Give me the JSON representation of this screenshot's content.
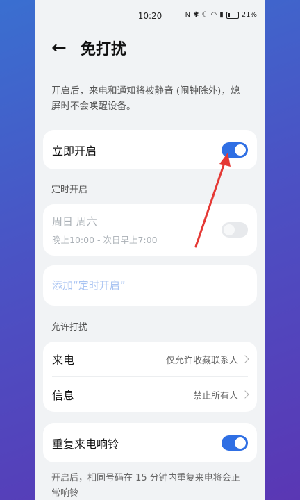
{
  "status_bar": {
    "time": "10:20",
    "icons": [
      "nfc-icon",
      "bluetooth-icon",
      "moon-icon",
      "wifi-icon",
      "sim-icon",
      "battery-icon"
    ],
    "battery": "21%"
  },
  "header": {
    "title": "免打扰"
  },
  "description": "开启后，来电和通知将被静音 (闹钟除外)，熄屏时不会唤醒设备。",
  "immediate": {
    "label": "立即开启",
    "enabled": true
  },
  "schedule": {
    "section_title": "定时开启",
    "days": "周日 周六",
    "time": "晚上10:00 - 次日早上7:00",
    "add_label": "添加“定时开启”"
  },
  "allow": {
    "section_title": "允许打扰",
    "calls": {
      "label": "来电",
      "value": "仅允许收藏联系人"
    },
    "messages": {
      "label": "信息",
      "value": "禁止所有人"
    }
  },
  "repeat": {
    "label": "重复来电响铃",
    "enabled": true,
    "note": "开启后，相同号码在 15 分钟内重复来电将会正常响铃"
  },
  "colors": {
    "accent": "#2f6fe4",
    "annotation_arrow": "#e53935"
  }
}
